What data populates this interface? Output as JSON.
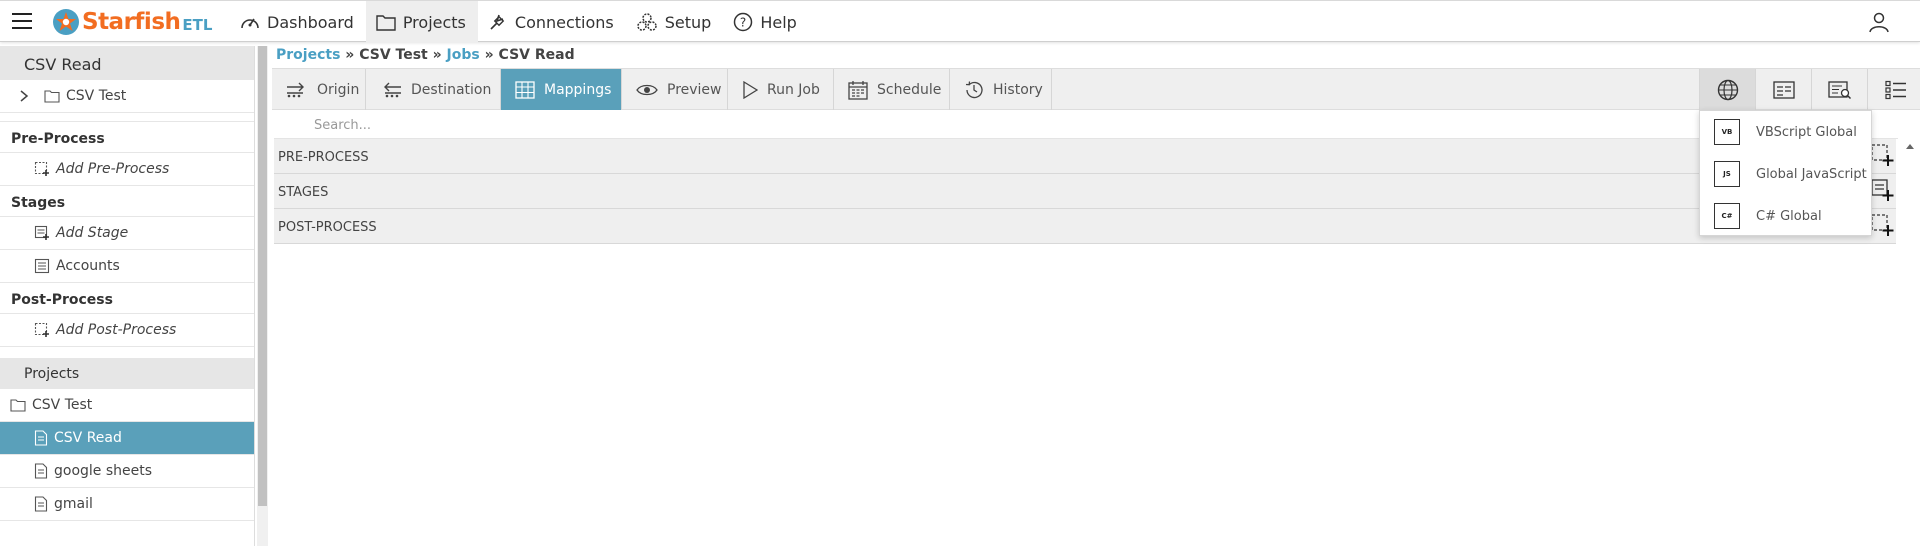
{
  "app": {
    "logo_text": "Starfish",
    "logo_suffix": "ETL",
    "brand_color": "#f26d21",
    "accent_color": "#5aa0ba"
  },
  "nav": {
    "items": [
      {
        "label": "Dashboard",
        "icon": "gauge-icon"
      },
      {
        "label": "Projects",
        "icon": "folder-icon",
        "active": true
      },
      {
        "label": "Connections",
        "icon": "plug-icon"
      },
      {
        "label": "Setup",
        "icon": "gears-icon"
      },
      {
        "label": "Help",
        "icon": "question-circle-icon"
      }
    ]
  },
  "sidebar": {
    "title": "CSV Read",
    "project_link": "CSV Test",
    "preprocess": {
      "header": "Pre-Process",
      "add_label": "Add Pre-Process"
    },
    "stages": {
      "header": "Stages",
      "add_label": "Add Stage",
      "items": [
        "Accounts"
      ]
    },
    "postprocess": {
      "header": "Post-Process",
      "add_label": "Add Post-Process"
    },
    "projects": {
      "header": "Projects",
      "folder": "CSV Test",
      "jobs": [
        {
          "label": "CSV Read",
          "selected": true
        },
        {
          "label": "google sheets"
        },
        {
          "label": "gmail"
        }
      ]
    }
  },
  "breadcrumb": {
    "projects": "Projects",
    "sep1": " » ",
    "project": "CSV Test",
    "sep2": " » ",
    "jobs": "Jobs",
    "sep3": " » ",
    "job": "CSV Read"
  },
  "tabs": [
    {
      "label": "Origin",
      "icon": "origin-icon"
    },
    {
      "label": "Destination",
      "icon": "destination-icon"
    },
    {
      "label": "Mappings",
      "icon": "table-icon",
      "active": true
    },
    {
      "label": "Preview",
      "icon": "eye-icon"
    },
    {
      "label": "Run Job",
      "icon": "play-icon"
    },
    {
      "label": "Schedule",
      "icon": "calendar-icon"
    },
    {
      "label": "History",
      "icon": "history-icon"
    }
  ],
  "search": {
    "placeholder": "Search..."
  },
  "sections": [
    {
      "label": "PRE-PROCESS"
    },
    {
      "label": "STAGES"
    },
    {
      "label": "POST-PROCESS"
    }
  ],
  "globals_menu": {
    "items": [
      {
        "badge": "VB",
        "label": "VBScript Global"
      },
      {
        "badge": "JS",
        "label": "Global JavaScript"
      },
      {
        "badge": "C#",
        "label": "C# Global"
      }
    ]
  }
}
